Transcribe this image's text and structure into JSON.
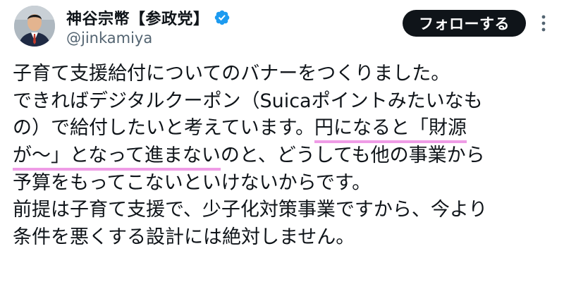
{
  "author": {
    "display_name": "神谷宗幣【参政党】",
    "handle": "@jinkamiya",
    "avatar_icon": "avatar-photo",
    "verified_icon": "verified-badge-icon",
    "verified_color": "#1d9bf0"
  },
  "actions": {
    "follow_label": "フォローする",
    "more_icon": "more-vertical-icon"
  },
  "post": {
    "lines": [
      {
        "text": "子育て支援給付についてのバナーをつくりました。"
      },
      {
        "text": "できればデジタルクーポン（Suicaポイントみたいなも"
      },
      {
        "pre": "の）で給付したいと考えています。",
        "highlight": "円になると「財源"
      },
      {
        "highlight": "が〜」となって進まない",
        "post": "のと、どうしても他の事業から"
      },
      {
        "text": "予算をもってこないといけないからです。"
      },
      {
        "text": "前提は子育て支援で、少子化対策事業ですから、今より"
      },
      {
        "text": "条件を悪くする設計には絶対しません。"
      }
    ],
    "highlight_color": "#ef9ce6"
  }
}
